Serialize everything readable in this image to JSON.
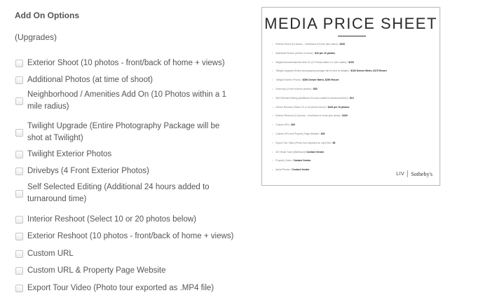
{
  "section": {
    "title": "Add On Options",
    "subtitle": "(Upgrades)"
  },
  "options": [
    {
      "lines": [
        "Exterior Shoot (10 photos - front/back of home + views)"
      ]
    },
    {
      "lines": [
        "Additional Photos (at time of shoot)"
      ]
    },
    {
      "lines": [
        "Neighborhood / Amenities Add On (10 Photos within a 1",
        "mile radius)"
      ]
    },
    {
      "lines": [
        "Twilight Upgrade (Entire Photography Package will be",
        "shot at Twilight)"
      ]
    },
    {
      "lines": [
        "Twilight Exterior Photos"
      ]
    },
    {
      "lines": [
        "Drivebys (4 Front Exterior Photos)"
      ]
    },
    {
      "lines": [
        "Self Selected Editing (Additional 24 hours added to",
        "turnaround time)"
      ]
    },
    {
      "lines": [
        "Interior Reshoot (Select 10 or 20 photos below)"
      ]
    },
    {
      "lines": [
        "Exterior Reshoot (10 photos - front/back of home + views)"
      ]
    },
    {
      "lines": [
        "Custom URL"
      ]
    },
    {
      "lines": [
        "Custom URL & Property Page Website"
      ]
    },
    {
      "lines": [
        "Export Tour Video (Photo tour exported as .MP4 file)"
      ]
    }
  ],
  "price_sheet": {
    "title": "MEDIA PRICE SHEET",
    "rows": [
      {
        "text": "Exterior Shoot (10 photos – front/back of home plus views) / ",
        "price": "$100"
      },
      {
        "text": "Additional Photos (at time of shoot) / ",
        "price": "$10 per 10 photos"
      },
      {
        "text": "Neighborhood/Amenities Add-On (10 Photos within a 1 mile radius) / ",
        "price": "$100"
      },
      {
        "text": "Twilight Upgrade (Entire photography package will be shot at twilight) / ",
        "price": "$100 Denver Metro, $175 Resort"
      },
      {
        "text": "Twilight Exterior Photos / ",
        "price": "$250 Denver Metro, $290 Resort"
      },
      {
        "text": "Drive-bys (4 front exterior photos) / ",
        "price": "$50"
      },
      {
        "text": "Self Selected Editing (Additional 24 hours added to turnaround time) / ",
        "price": "$10"
      },
      {
        "text": "Interior Reshoot (Select 10 or 20 photos below) / ",
        "price": "$100 per 10 photos"
      },
      {
        "text": "Exterior Reshoot (10 photos – front/back of home plus views) / ",
        "price": "$100"
      },
      {
        "text": "Custom URL / ",
        "price": "$20"
      },
      {
        "text": "Custom URL and Property Page Website / ",
        "price": "$30"
      },
      {
        "text": "Export Tour Video (Photo tour exported as .mp4 file) / ",
        "price": "$5"
      },
      {
        "text": "3D Virtual Tours (Matterport) ",
        "price": "Contact Vendor"
      },
      {
        "text": "Property Video / ",
        "price": "Contact Vendor"
      },
      {
        "text": "Aerial Photos / ",
        "price": "Contact Vendor"
      }
    ],
    "brand_liv": "LIV",
    "brand_sothebys": "Sotheby's"
  }
}
